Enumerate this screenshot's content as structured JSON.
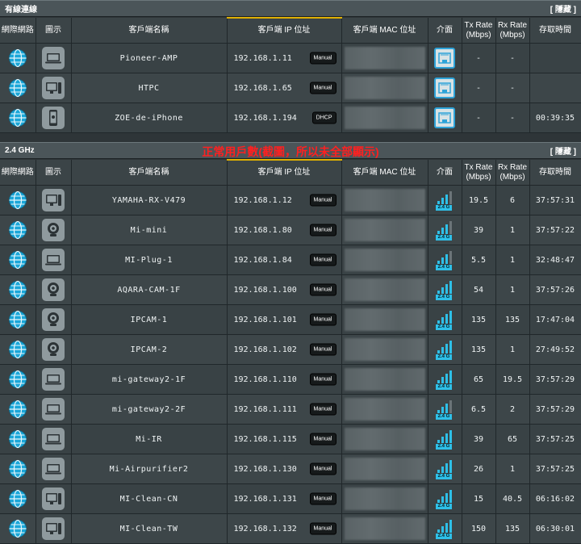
{
  "wired": {
    "title": "有線連線",
    "hide_label": "[ 隱藏 ]",
    "headers": [
      "網際網路",
      "圖示",
      "客戶端名稱",
      "客戶端 IP 位址",
      "客戶端 MAC 位址",
      "介面",
      "Tx Rate\n(Mbps)",
      "Rx Rate\n(Mbps)",
      "存取時間"
    ],
    "rows": [
      {
        "name": "Pioneer-AMP",
        "ip": "192.168.1.11",
        "mode": "Manual",
        "device": "laptop",
        "tx": "-",
        "rx": "-",
        "time": ""
      },
      {
        "name": "HTPC",
        "ip": "192.168.1.65",
        "mode": "Manual",
        "device": "desktop",
        "tx": "-",
        "rx": "-",
        "time": ""
      },
      {
        "name": "ZOE-de-iPhone",
        "ip": "192.168.1.194",
        "mode": "DHCP",
        "device": "phone",
        "tx": "-",
        "rx": "-",
        "time": "00:39:35"
      }
    ]
  },
  "wifi24": {
    "title": "2.4 GHz",
    "hide_label": "[ 隱藏 ]",
    "note": "正常用戶數(截圖，所以未全部顯示)",
    "band_label": "2.4 G",
    "headers": [
      "網際網路",
      "圖示",
      "客戶端名稱",
      "客戶端 IP 位址",
      "客戶端 MAC 位址",
      "介面",
      "Tx Rate\n(Mbps)",
      "Rx Rate\n(Mbps)",
      "存取時間"
    ],
    "rows": [
      {
        "name": "YAMAHA-RX-V479",
        "ip": "192.168.1.12",
        "mode": "Manual",
        "device": "desktop",
        "tx": "19.5",
        "rx": "6",
        "time": "37:57:31",
        "signal": 3
      },
      {
        "name": "Mi-mini",
        "ip": "192.168.1.80",
        "mode": "Manual",
        "device": "camera",
        "tx": "39",
        "rx": "1",
        "time": "37:57:22",
        "signal": 3
      },
      {
        "name": "MI-Plug-1",
        "ip": "192.168.1.84",
        "mode": "Manual",
        "device": "laptop",
        "tx": "5.5",
        "rx": "1",
        "time": "32:48:47",
        "signal": 3
      },
      {
        "name": "AQARA-CAM-1F",
        "ip": "192.168.1.100",
        "mode": "Manual",
        "device": "camera",
        "tx": "54",
        "rx": "1",
        "time": "37:57:26",
        "signal": 4
      },
      {
        "name": "IPCAM-1",
        "ip": "192.168.1.101",
        "mode": "Manual",
        "device": "camera",
        "tx": "135",
        "rx": "135",
        "time": "17:47:04",
        "signal": 4
      },
      {
        "name": "IPCAM-2",
        "ip": "192.168.1.102",
        "mode": "Manual",
        "device": "camera",
        "tx": "135",
        "rx": "1",
        "time": "27:49:52",
        "signal": 4
      },
      {
        "name": "mi-gateway2-1F",
        "ip": "192.168.1.110",
        "mode": "Manual",
        "device": "laptop",
        "tx": "65",
        "rx": "19.5",
        "time": "37:57:29",
        "signal": 4
      },
      {
        "name": "mi-gateway2-2F",
        "ip": "192.168.1.111",
        "mode": "Manual",
        "device": "laptop",
        "tx": "6.5",
        "rx": "2",
        "time": "37:57:29",
        "signal": 3
      },
      {
        "name": "Mi-IR",
        "ip": "192.168.1.115",
        "mode": "Manual",
        "device": "laptop",
        "tx": "39",
        "rx": "65",
        "time": "37:57:25",
        "signal": 4
      },
      {
        "name": "Mi-Airpurifier2",
        "ip": "192.168.1.130",
        "mode": "Manual",
        "device": "laptop",
        "tx": "26",
        "rx": "1",
        "time": "37:57:25",
        "signal": 4
      },
      {
        "name": "MI-Clean-CN",
        "ip": "192.168.1.131",
        "mode": "Manual",
        "device": "desktop",
        "tx": "15",
        "rx": "40.5",
        "time": "06:16:02",
        "signal": 4
      },
      {
        "name": "MI-Clean-TW",
        "ip": "192.168.1.132",
        "mode": "Manual",
        "device": "desktop",
        "tx": "150",
        "rx": "135",
        "time": "06:30:01",
        "signal": 4
      }
    ]
  },
  "colors": {
    "accent": "#2ec0e8",
    "note": "#ff2020",
    "ip_header_accent": "#e0b000"
  }
}
